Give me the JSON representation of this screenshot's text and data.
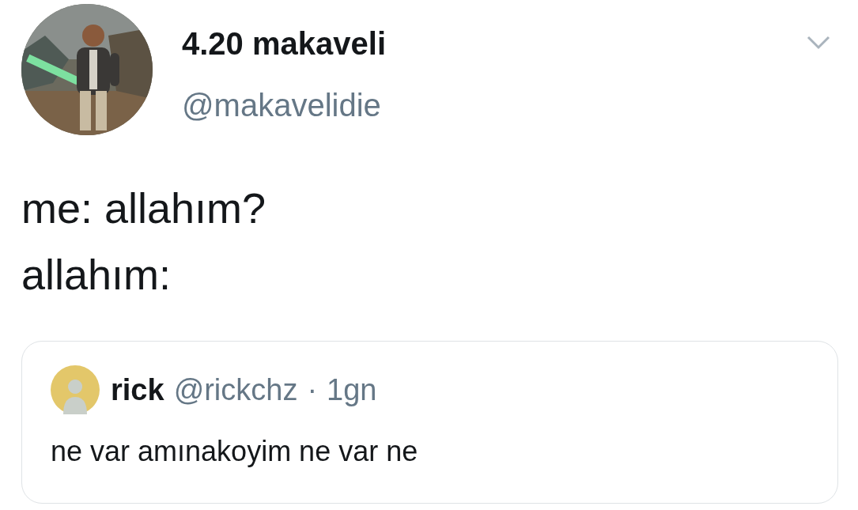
{
  "author": {
    "name": "4.20 makaveli",
    "handle": "@makavelidie"
  },
  "text_lines": [
    "me: allahım?",
    "allahım:"
  ],
  "quoted_tweet": {
    "name": "rick",
    "handle": "@rickchz",
    "separator": "·",
    "time": "1gn",
    "text": "ne var amınakoyim ne var ne"
  }
}
